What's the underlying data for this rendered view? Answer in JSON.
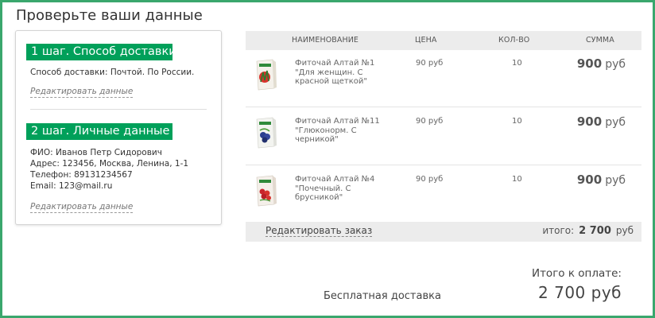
{
  "page_title": "Проверьте ваши данные",
  "colors": {
    "accent": "#00a05a",
    "frame": "#3aa76d",
    "header_bg": "#ececec"
  },
  "steps": [
    {
      "badge": "1 шаг. Способ доставки",
      "lines": [
        "Способ доставки: Почтой. По России."
      ],
      "edit_label": "Редактировать данные"
    },
    {
      "badge": "2 шаг. Личные данные",
      "lines": [
        "ФИО: Иванов Петр Сидорович",
        "Адрес: 123456, Москва, Ленина, 1-1",
        "Телефон: 89131234567",
        "Email: 123@mail.ru"
      ],
      "edit_label": "Редактировать данные"
    }
  ],
  "table": {
    "headers": {
      "name": "НАИМЕНОВАНИЕ",
      "price": "ЦЕНА",
      "qty": "КОЛ-ВО",
      "sum": "СУММА"
    },
    "rows": [
      {
        "name_line1": "Фиточай Алтай №1",
        "name_line2": "\"Для женщин. С",
        "name_line3": "красной щеткой\"",
        "price": "90 руб",
        "qty": "10",
        "sum": "900",
        "currency": "руб",
        "icon": "tea-box-red-icon"
      },
      {
        "name_line1": "Фиточай Алтай №11",
        "name_line2": "\"Глюконорм. С",
        "name_line3": "черникой\"",
        "price": "90 руб",
        "qty": "10",
        "sum": "900",
        "currency": "руб",
        "icon": "tea-box-blue-icon"
      },
      {
        "name_line1": "Фиточай Алтай №4",
        "name_line2": "\"Почечный. С",
        "name_line3": "брусникой\"",
        "price": "90 руб",
        "qty": "10",
        "sum": "900",
        "currency": "руб",
        "icon": "tea-box-berry-icon"
      }
    ],
    "edit_order_label": "Редактировать заказ",
    "total_label": "итого:",
    "total_value": "2 700",
    "total_currency": "руб"
  },
  "summary": {
    "free_delivery": "Бесплатная доставка",
    "pay_label": "Итого к оплате:",
    "pay_amount": "2 700 руб"
  }
}
